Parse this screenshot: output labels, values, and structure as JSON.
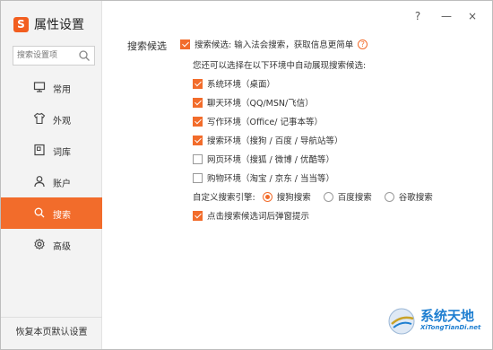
{
  "app": {
    "logo_text": "S",
    "title": "属性设置",
    "accent": "#f26c2b"
  },
  "titlebar": {
    "help_label": "?",
    "minimize_label": "—",
    "close_label": "×"
  },
  "sidebar": {
    "search_placeholder": "搜索设置项",
    "items": [
      {
        "label": "常用",
        "icon": "monitor-icon"
      },
      {
        "label": "外观",
        "icon": "shirt-icon"
      },
      {
        "label": "词库",
        "icon": "book-icon"
      },
      {
        "label": "账户",
        "icon": "user-icon"
      },
      {
        "label": "搜索",
        "icon": "search-icon",
        "active": true
      },
      {
        "label": "高级",
        "icon": "gear-icon"
      }
    ],
    "reset_label": "恢复本页默认设置"
  },
  "main": {
    "section_title": "搜索候选",
    "main_option": {
      "label": "搜索候选: 输入法会搜索，获取信息更简单",
      "checked": true
    },
    "subtitle": "您还可以选择在以下环境中自动展现搜索候选:",
    "env_options": [
      {
        "label": "系统环境（桌面）",
        "checked": true
      },
      {
        "label": "聊天环境（QQ/MSN/飞信）",
        "checked": true
      },
      {
        "label": "写作环境（Office/ 记事本等）",
        "checked": true
      },
      {
        "label": "搜索环境（搜狗 / 百度 / 导航站等）",
        "checked": true
      },
      {
        "label": "网页环境（搜狐 / 微博 / 优酷等）",
        "checked": false
      },
      {
        "label": "购物环境（淘宝 / 京东 / 当当等）",
        "checked": false
      }
    ],
    "engine_label": "自定义搜索引擎:",
    "engines": [
      {
        "label": "搜狗搜索",
        "checked": true
      },
      {
        "label": "百度搜索",
        "checked": false
      },
      {
        "label": "谷歌搜索",
        "checked": false
      }
    ],
    "popup_option": {
      "label": "点击搜索候选词后弹窗提示",
      "checked": true
    }
  },
  "watermark": {
    "title": "系统天地",
    "subtitle": "XiTongTianDi.net"
  }
}
